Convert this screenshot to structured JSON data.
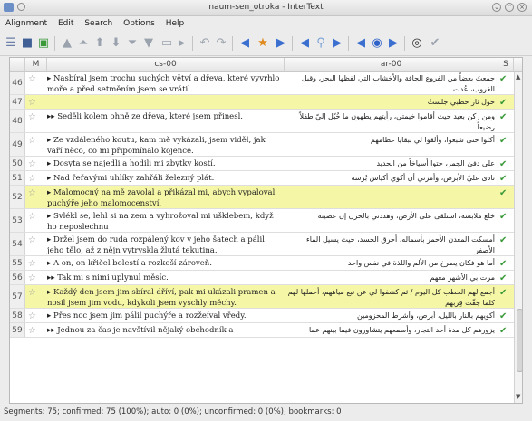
{
  "window": {
    "title": "naum-sen_otroka - InterText"
  },
  "menu": [
    "Alignment",
    "Edit",
    "Search",
    "Options",
    "Help"
  ],
  "table": {
    "col_m": "M",
    "col_cs": "cs-00",
    "col_ar": "ar-00",
    "col_s": "S",
    "rows": [
      {
        "num": "46",
        "cs": "▸ Nasbíral jsem trochu suchých větví a dřeva, které vyvrhlo moře a před setměním jsem se vrátil.",
        "ar": "جمعتُ بعضاً من الفروع الجافة والأخشاب التي لفظها البحر، وقبل الغروب، عُدت",
        "sel": false
      },
      {
        "num": "47",
        "cs": "",
        "ar": "حول نار حطبي جلستُ",
        "sel": true
      },
      {
        "num": "48",
        "cs": "▸▸ Seděli kolem ohně ze dřeva, které jsem přinesl.",
        "ar": "ومن ركن بعيد حيث أقاموا خيمتي، رأيتهم يطهون ما خُيّل إليّ طفلاً رضيعاً",
        "sel": false
      },
      {
        "num": "49",
        "cs": "▸ Ze vzdáleného koutu, kam mě vykázali, jsem viděl, jak vaří něco, co mi připomínalo kojence.",
        "ar": "أكلوا حتى شبعوا، وألقوا لي ببقايا عظامهم",
        "sel": false
      },
      {
        "num": "50",
        "cs": "▸ Dosyta se najedli a hodili mi zbytky kostí.",
        "ar": "على دفئ الجمر، حتوا أسياخاً من الحديد",
        "sel": false
      },
      {
        "num": "51",
        "cs": "▸ Nad řeřavými uhlíky zahřáli železný plát.",
        "ar": "نادى عليّ الأبرص، وأمرني أن أكوي أكياس بُرَسه",
        "sel": false
      },
      {
        "num": "52",
        "cs": "▸ Malomocný na mě zavolal a přikázal mi, abych vypaloval puchýře jeho malomocenství.",
        "ar": "",
        "sel": true
      },
      {
        "num": "53",
        "cs": "▸ Svlékl se, lehl si na zem a vyhrožoval mi ušklebem, když ho neposlechnu",
        "ar": "خلع ملابسه، استلقى على الأرض، وهددني بالحزن إن عصيته",
        "sel": false
      },
      {
        "num": "54",
        "cs": "▸ Držel jsem do ruda rozpálený kov v jeho šatech a pálil jeho tělo, až z nějn vytryskla žlutá tekutina.",
        "ar": "أمسكت المعدن الأحمر بأسماله، أحرق الجسد، حيث يسيل الماء الأصفر",
        "sel": false
      },
      {
        "num": "55",
        "cs": "▸ A on, on křičel bolestí a rozkoší zároveň.",
        "ar": "أما هو فكان يصرخ من الألم واللذة في نفس واحد",
        "sel": false
      },
      {
        "num": "56",
        "cs": "▸▸ Tak mi s nimi uplynul měsíc.",
        "ar": "مرت بي الأشهر معهم",
        "sel": false
      },
      {
        "num": "57",
        "cs": "▸ Každý den jsem jim sbíral dříví, pak mi ukázali pramen a nosil jsem jim vodu, kdykoli jsem vyschly měchy.",
        "ar": "أجمع لهم الحطب كل اليوم / ثم كشفوا لي عن نبع مياههم، أحملها لهم كلما جفّت قِربهم",
        "sel": true
      },
      {
        "num": "58",
        "cs": "▸ Přes noc jsem jim pálil puchýře a rozžeíval vředy.",
        "ar": "أكويهم بالنار بالليل، أبرص، وأشرط المحزومين",
        "sel": false
      },
      {
        "num": "59",
        "cs": "▸▸ Jednou za čas je navštívil nějaký obchodník a",
        "ar": "يزورهم كل مدة أحد التجار، وأسمعهم يتشاورون فيما بينهم عما",
        "sel": false
      }
    ]
  },
  "status": "Segments: 75; confirmed: 75 (100%); auto: 0 (0%); unconfirmed: 0 (0%); bookmarks: 0"
}
